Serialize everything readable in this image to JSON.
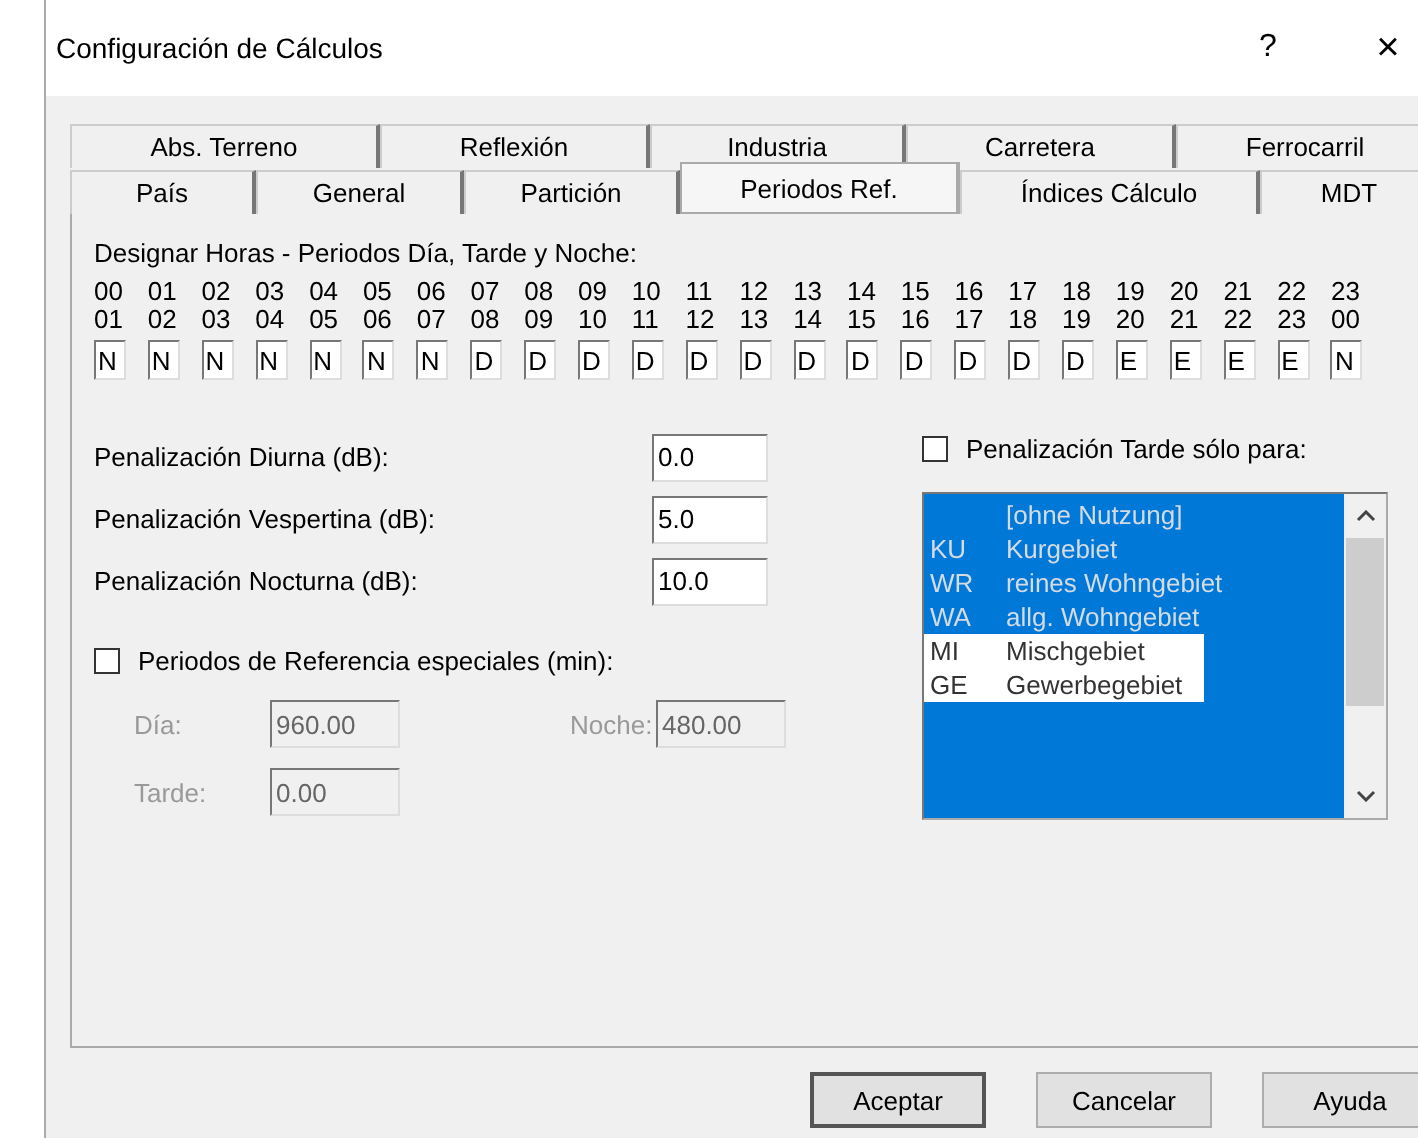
{
  "window": {
    "title": "Configuración de Cálculos",
    "help_button": "?",
    "close_button": "×"
  },
  "tabs": [
    [
      {
        "label": "Abs. Terreno",
        "selected": false
      },
      {
        "label": "Reflexión",
        "selected": false
      },
      {
        "label": "Industria",
        "selected": false
      },
      {
        "label": "Carretera",
        "selected": false
      },
      {
        "label": "Ferrocarril",
        "selected": false
      }
    ],
    [
      {
        "label": "País",
        "selected": false
      },
      {
        "label": "General",
        "selected": false
      },
      {
        "label": "Partición",
        "selected": false
      },
      {
        "label": "Periodos Ref.",
        "selected": true
      },
      {
        "label": "Índices Cálculo",
        "selected": false
      },
      {
        "label": "MDT",
        "selected": false
      }
    ]
  ],
  "hours": {
    "heading": "Designar Horas - Periodos Día, Tarde y Noche:",
    "slots": [
      {
        "from": "00",
        "to": "01",
        "value": "N"
      },
      {
        "from": "01",
        "to": "02",
        "value": "N"
      },
      {
        "from": "02",
        "to": "03",
        "value": "N"
      },
      {
        "from": "03",
        "to": "04",
        "value": "N"
      },
      {
        "from": "04",
        "to": "05",
        "value": "N"
      },
      {
        "from": "05",
        "to": "06",
        "value": "N"
      },
      {
        "from": "06",
        "to": "07",
        "value": "N"
      },
      {
        "from": "07",
        "to": "08",
        "value": "D"
      },
      {
        "from": "08",
        "to": "09",
        "value": "D"
      },
      {
        "from": "09",
        "to": "10",
        "value": "D"
      },
      {
        "from": "10",
        "to": "11",
        "value": "D"
      },
      {
        "from": "11",
        "to": "12",
        "value": "D"
      },
      {
        "from": "12",
        "to": "13",
        "value": "D"
      },
      {
        "from": "13",
        "to": "14",
        "value": "D"
      },
      {
        "from": "14",
        "to": "15",
        "value": "D"
      },
      {
        "from": "15",
        "to": "16",
        "value": "D"
      },
      {
        "from": "16",
        "to": "17",
        "value": "D"
      },
      {
        "from": "17",
        "to": "18",
        "value": "D"
      },
      {
        "from": "18",
        "to": "19",
        "value": "D"
      },
      {
        "from": "19",
        "to": "20",
        "value": "E"
      },
      {
        "from": "20",
        "to": "21",
        "value": "E"
      },
      {
        "from": "21",
        "to": "22",
        "value": "E"
      },
      {
        "from": "22",
        "to": "23",
        "value": "E"
      },
      {
        "from": "23",
        "to": "00",
        "value": "N"
      }
    ]
  },
  "penalties": [
    {
      "label": "Penalización Diurna (dB):",
      "value": "0.0"
    },
    {
      "label": "Penalización Vespertina (dB):",
      "value": "5.0"
    },
    {
      "label": "Penalización Nocturna (dB):",
      "value": "10.0"
    }
  ],
  "special_periods": {
    "label": "Periodos de Referencia especiales (min):",
    "checked": false,
    "fields": [
      {
        "label": "Día:",
        "value": "960.00",
        "disabled": true
      },
      {
        "label": "Noche:",
        "value": "480.00",
        "disabled": true
      },
      {
        "label": "Tarde:",
        "value": "0.00",
        "disabled": true
      }
    ]
  },
  "evening_only": {
    "label": "Penalización Tarde sólo para:",
    "checked": false,
    "items": [
      {
        "name": "[ohne Nutzung]",
        "selected": true
      },
      {
        "code": "KU",
        "name": "Kurgebiet",
        "selected": true
      },
      {
        "code": "WR",
        "name": "reines Wohngebiet",
        "selected": true
      },
      {
        "code": "WA",
        "name": "allg. Wohngebiet",
        "selected": true
      },
      {
        "code": "MI",
        "name": "Mischgebiet",
        "selected": false
      },
      {
        "code": "GE",
        "name": "Gewerbegebiet",
        "selected": false
      }
    ]
  },
  "buttons": [
    "Aceptar",
    "Cancelar",
    "Ayuda"
  ]
}
